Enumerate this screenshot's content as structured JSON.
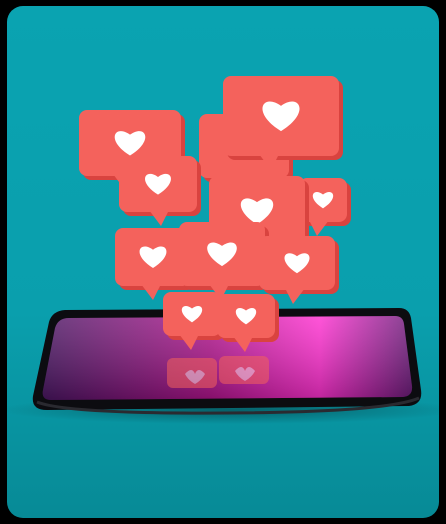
{
  "image": {
    "background_color": "#000000",
    "card_color": "#0aa3b1",
    "bubble_color": "#f4625c",
    "bubble_shade": "#d9433f",
    "heart_color": "#ffffff",
    "screen_gradient": [
      "#5c1a6e",
      "#c2148f",
      "#ff2fd0"
    ],
    "phone_bezel": "#0c0c10",
    "icons": [
      "heart-icon",
      "speech-bubble-icon",
      "smartphone-icon"
    ],
    "bubbles": [
      {
        "row": 1,
        "count": 2
      },
      {
        "row": 2,
        "count": 3
      },
      {
        "row": 3,
        "count": 3
      },
      {
        "row": 4,
        "count": 3
      },
      {
        "row": 5,
        "count": 2
      }
    ]
  }
}
